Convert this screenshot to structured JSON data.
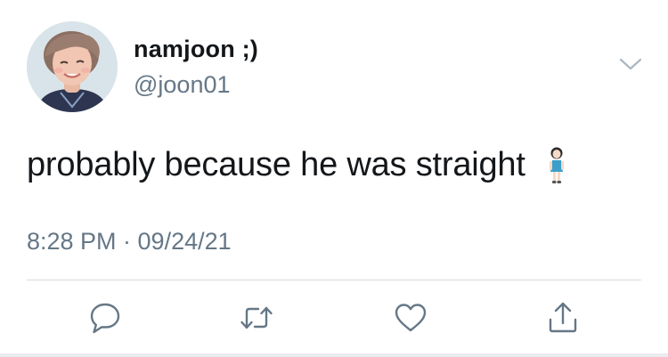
{
  "user": {
    "display_name": "namjoon ;)",
    "handle": "@joon01",
    "avatar_icon": "profile-photo"
  },
  "tweet": {
    "text": "probably because he was straight",
    "emoji_icon": "standing-person-emoji",
    "timestamp": "8:28 PM · 09/24/21"
  },
  "actions": [
    {
      "name": "reply",
      "icon": "speech-bubble-icon"
    },
    {
      "name": "retweet",
      "icon": "retweet-arrows-icon"
    },
    {
      "name": "like",
      "icon": "heart-icon"
    },
    {
      "name": "share",
      "icon": "share-upload-icon"
    }
  ],
  "menu": {
    "icon": "chevron-down-icon"
  },
  "colors": {
    "primary_text": "#14171a",
    "secondary_text": "#657786",
    "divider": "#d6dde2",
    "icon_gray": "#657786"
  }
}
